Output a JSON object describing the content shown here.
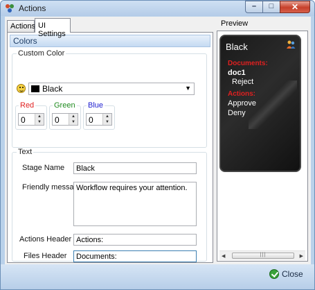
{
  "window": {
    "title": "Actions"
  },
  "tabs": [
    {
      "label": "Actions",
      "active": false
    },
    {
      "label": "UI Settings",
      "active": true
    }
  ],
  "colors_section": {
    "header": "Colors",
    "custom_color_group": "Custom Color",
    "selected_color": "Black",
    "selected_swatch": "#000000",
    "red": {
      "label": "Red",
      "value": "0",
      "color": "#e02020"
    },
    "green": {
      "label": "Green",
      "value": "0",
      "color": "#1f8a1f"
    },
    "blue": {
      "label": "Blue",
      "value": "0",
      "color": "#2020d0"
    }
  },
  "text_section": {
    "group": "Text",
    "stage_name": {
      "label": "Stage Name",
      "value": "Black"
    },
    "friendly_message": {
      "label": "Friendly message",
      "value": "Workflow requires your attention."
    },
    "actions_header": {
      "label": "Actions Header",
      "value": "Actions:"
    },
    "files_header": {
      "label": "Files Header",
      "value": "Documents:"
    }
  },
  "preview": {
    "label": "Preview",
    "card_title": "Black",
    "documents_header": "Documents:",
    "document": "doc1",
    "document_action": "Reject",
    "actions_header": "Actions:",
    "actions": [
      "Approve",
      "Deny"
    ]
  },
  "footer": {
    "close_label": "Close"
  }
}
